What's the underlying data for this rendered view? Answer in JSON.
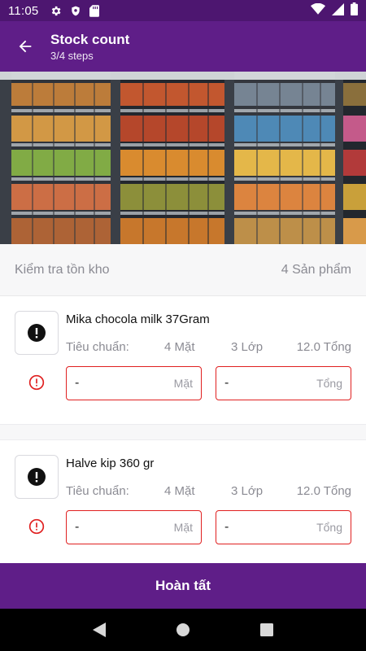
{
  "status_bar": {
    "time": "11:05"
  },
  "app_bar": {
    "title": "Stock count",
    "steps": "3/4 steps"
  },
  "summary": {
    "label": "Kiểm tra tồn kho",
    "count": "4 Sản phẩm"
  },
  "products": [
    {
      "name": "Mika chocola milk 37Gram",
      "spec_label": "Tiêu chuẩn:",
      "spec_faces": "4 Mặt",
      "spec_layers": "3 Lớp",
      "spec_total": "12.0 Tổng",
      "faces_value": "-",
      "faces_unit": "Mặt",
      "total_value": "-",
      "total_unit": "Tổng"
    },
    {
      "name": "Halve kip 360 gr",
      "spec_label": "Tiêu chuẩn:",
      "spec_faces": "4 Mặt",
      "spec_layers": "3 Lớp",
      "spec_total": "12.0 Tổng",
      "faces_value": "-",
      "faces_unit": "Mặt",
      "total_value": "-",
      "total_unit": "Tổng"
    }
  ],
  "finish_button": "Hoàn tất",
  "icons": {
    "back": "arrow-left-icon",
    "product_status": "alert-filled-icon",
    "row_warning": "alert-outline-icon",
    "nav": [
      "back-triangle-icon",
      "home-circle-icon",
      "recents-square-icon"
    ]
  },
  "colors": {
    "primary": "#5f1e88",
    "status_bar": "#4d1670",
    "error": "#e02020",
    "muted_text": "#8b8b93"
  }
}
